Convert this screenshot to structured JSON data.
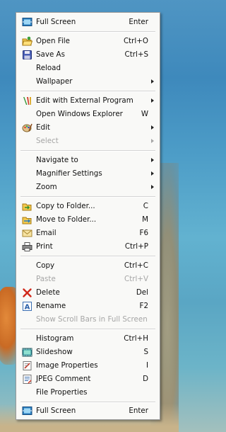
{
  "menu": {
    "items": [
      {
        "label": "Full Screen",
        "shortcut": "Enter",
        "icon": "full-screen-icon"
      },
      {
        "label": "Open File",
        "shortcut": "Ctrl+O",
        "icon": "open-folder-icon"
      },
      {
        "label": "Save As",
        "shortcut": "Ctrl+S",
        "icon": "save-disk-icon"
      },
      {
        "label": "Reload",
        "shortcut": ""
      },
      {
        "label": "Wallpaper",
        "shortcut": "",
        "submenu": true
      },
      {
        "label": "Edit with External Program",
        "shortcut": "",
        "submenu": true,
        "icon": "external-program-icon"
      },
      {
        "label": "Open Windows Explorer",
        "shortcut": "W"
      },
      {
        "label": "Edit",
        "shortcut": "",
        "submenu": true,
        "icon": "palette-icon"
      },
      {
        "label": "Select",
        "shortcut": "",
        "submenu": true,
        "disabled": true
      },
      {
        "label": "Navigate to",
        "shortcut": "",
        "submenu": true
      },
      {
        "label": "Magnifier Settings",
        "shortcut": "",
        "submenu": true
      },
      {
        "label": "Zoom",
        "shortcut": "",
        "submenu": true
      },
      {
        "label": "Copy to Folder...",
        "shortcut": "C",
        "icon": "copy-folder-icon"
      },
      {
        "label": "Move to Folder...",
        "shortcut": "M",
        "icon": "move-folder-icon"
      },
      {
        "label": "Email",
        "shortcut": "F6",
        "icon": "email-icon"
      },
      {
        "label": "Print",
        "shortcut": "Ctrl+P",
        "icon": "printer-icon"
      },
      {
        "label": "Copy",
        "shortcut": "Ctrl+C"
      },
      {
        "label": "Paste",
        "shortcut": "Ctrl+V",
        "disabled": true
      },
      {
        "label": "Delete",
        "shortcut": "Del",
        "icon": "delete-x-icon"
      },
      {
        "label": "Rename",
        "shortcut": "F2",
        "icon": "rename-icon"
      },
      {
        "label": "Show Scroll Bars in Full Screen",
        "shortcut": "",
        "disabled": true
      },
      {
        "label": "Histogram",
        "shortcut": "Ctrl+H"
      },
      {
        "label": "Slideshow",
        "shortcut": "S",
        "icon": "slideshow-icon"
      },
      {
        "label": "Image Properties",
        "shortcut": "I",
        "icon": "image-properties-icon"
      },
      {
        "label": "JPEG Comment",
        "shortcut": "D",
        "icon": "jpeg-comment-icon"
      },
      {
        "label": "File Properties",
        "shortcut": ""
      },
      {
        "label": "Full Screen",
        "shortcut": "Enter",
        "icon": "full-screen-icon"
      }
    ]
  }
}
